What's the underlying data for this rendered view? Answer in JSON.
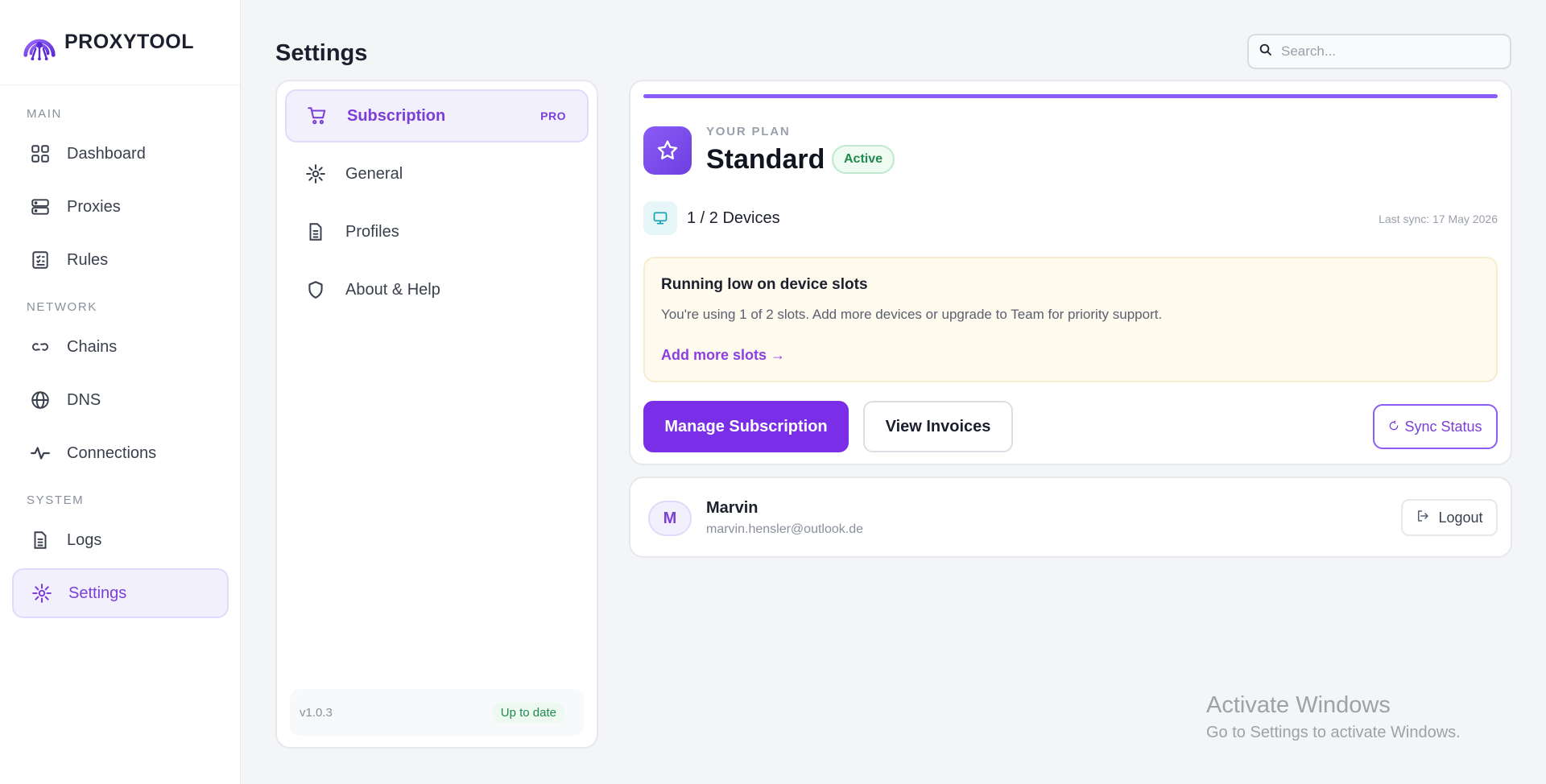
{
  "app": {
    "brand": "PROXYTOOL"
  },
  "sidebar": {
    "sections": [
      {
        "title": "MAIN",
        "items": [
          {
            "label": "Dashboard",
            "icon": "dashboard-icon"
          },
          {
            "label": "Proxies",
            "icon": "server-icon"
          },
          {
            "label": "Rules",
            "icon": "checklist-icon"
          }
        ]
      },
      {
        "title": "NETWORK",
        "items": [
          {
            "label": "Chains",
            "icon": "link-icon"
          },
          {
            "label": "DNS",
            "icon": "globe-icon"
          },
          {
            "label": "Connections",
            "icon": "activity-icon"
          }
        ]
      },
      {
        "title": "SYSTEM",
        "items": [
          {
            "label": "Logs",
            "icon": "document-icon"
          },
          {
            "label": "Settings",
            "icon": "gear-icon",
            "active": true
          }
        ]
      }
    ]
  },
  "header": {
    "title": "Settings",
    "search_placeholder": "Search..."
  },
  "settings_menu": {
    "items": [
      {
        "label": "Subscription",
        "badge": "PRO",
        "icon": "cart-icon",
        "active": true
      },
      {
        "label": "General",
        "icon": "gear-icon"
      },
      {
        "label": "Profiles",
        "icon": "document-icon"
      },
      {
        "label": "About & Help",
        "icon": "shield-icon"
      }
    ],
    "version": "v1.0.3",
    "update_status": "Up to date"
  },
  "plan": {
    "eyebrow": "YOUR PLAN",
    "name": "Standard",
    "status": "Active",
    "devices": "1 / 2 Devices",
    "last_sync": "Last sync: 17 May 2026",
    "alert": {
      "title": "Running low on device slots",
      "text": "You're using 1 of 2 slots. Add more devices or upgrade to Team for priority support.",
      "link": "Add more slots →"
    },
    "buttons": {
      "manage": "Manage Subscription",
      "invoices": "View Invoices",
      "sync": "Sync Status"
    }
  },
  "account": {
    "initial": "M",
    "name": "Marvin",
    "email": "marvin.hensler@outlook.de",
    "logout": "Logout"
  },
  "watermark": {
    "title": "Activate Windows",
    "subtitle": "Go to Settings to activate Windows."
  },
  "colors": {
    "accent": "#7b2ee8",
    "accent_light": "#f3f0fd",
    "success": "#1f8a4c",
    "warning_bg": "#fefaee"
  }
}
